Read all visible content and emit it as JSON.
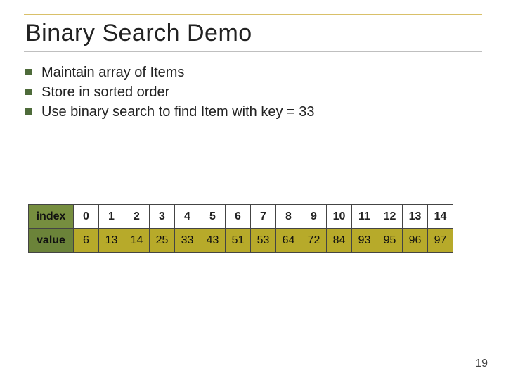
{
  "title": "Binary Search Demo",
  "bullets": [
    "Maintain array of Items",
    "Store in sorted order",
    "Use binary search to find Item with key = 33"
  ],
  "table": {
    "indexLabel": "index",
    "valueLabel": "value",
    "index": [
      "0",
      "1",
      "2",
      "3",
      "4",
      "5",
      "6",
      "7",
      "8",
      "9",
      "10",
      "11",
      "12",
      "13",
      "14"
    ],
    "value": [
      "6",
      "13",
      "14",
      "25",
      "33",
      "43",
      "51",
      "53",
      "64",
      "72",
      "84",
      "93",
      "95",
      "96",
      "97"
    ]
  },
  "pageNumber": "19",
  "chart_data": {
    "type": "table",
    "title": "Binary Search Demo array",
    "columns": [
      "index",
      "value"
    ],
    "rows": [
      [
        0,
        6
      ],
      [
        1,
        13
      ],
      [
        2,
        14
      ],
      [
        3,
        25
      ],
      [
        4,
        33
      ],
      [
        5,
        43
      ],
      [
        6,
        51
      ],
      [
        7,
        53
      ],
      [
        8,
        64
      ],
      [
        9,
        72
      ],
      [
        10,
        84
      ],
      [
        11,
        93
      ],
      [
        12,
        95
      ],
      [
        13,
        96
      ],
      [
        14,
        97
      ]
    ],
    "search_key": 33
  }
}
